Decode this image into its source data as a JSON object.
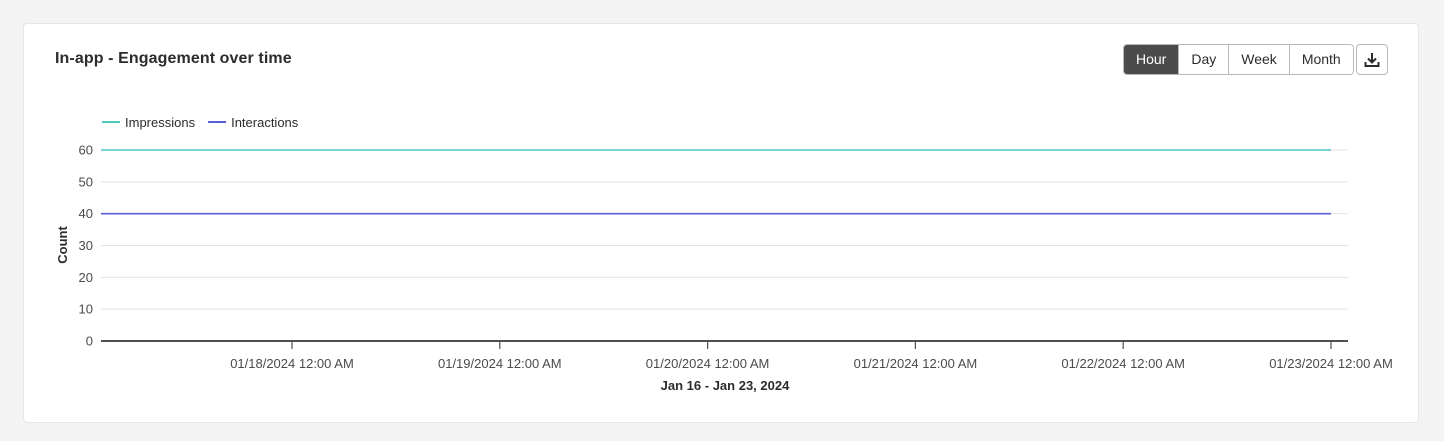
{
  "header": {
    "title": "In-app - Engagement over time"
  },
  "granularity": {
    "options": [
      "Hour",
      "Day",
      "Week",
      "Month"
    ],
    "selected": "Hour"
  },
  "download": {
    "icon": "download-icon"
  },
  "colors": {
    "impressions": "#4fc9c0",
    "interactions": "#5a5fd6",
    "grid": "#e3e3e3",
    "axis": "#505050",
    "selected_bg": "#4b4b4b"
  },
  "chart_data": {
    "type": "line",
    "ylabel": "Count",
    "xlabel": "Jan 16 - Jan 23, 2024",
    "ylim": [
      0,
      60
    ],
    "yticks": [
      0,
      10,
      20,
      30,
      40,
      50,
      60
    ],
    "xticks": [
      "01/18/2024 12:00 AM",
      "01/19/2024 12:00 AM",
      "01/20/2024 12:00 AM",
      "01/21/2024 12:00 AM",
      "01/22/2024 12:00 AM",
      "01/23/2024 12:00 AM"
    ],
    "legend": {
      "position": "top-left"
    },
    "grid": true,
    "series": [
      {
        "name": "Impressions",
        "x": [
          "01/17/2024 12:00 AM",
          "01/23/2024 12:00 AM"
        ],
        "values": [
          60,
          60
        ]
      },
      {
        "name": "Interactions",
        "x": [
          "01/17/2024 12:00 AM",
          "01/23/2024 12:00 AM"
        ],
        "values": [
          40,
          40
        ]
      }
    ]
  }
}
